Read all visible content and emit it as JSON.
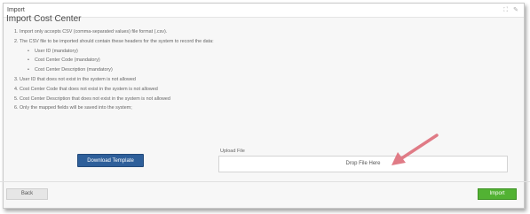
{
  "window": {
    "title": "Import",
    "controls": "⛶ ✎"
  },
  "page": {
    "heading": "Import Cost Center",
    "rules": [
      "1. Import only accepts CSV (comma-separated values) file format (.csv).",
      "2. The CSV file to be imported should contain these headers for the system to record the data:",
      "User ID (mandatory)",
      "Cost Center Code (mandatory)",
      "Cost Center Description (mandatory)",
      "3. User ID that does not exist in the system is not allowed",
      "4. Cost Center Code that does not exist in the system is not allowed",
      "5. Cost Center Description that does not exist in the system is not allowed",
      "6. Only the mapped fields will be saved into the system;"
    ],
    "bullet": "•"
  },
  "download": {
    "label": "Download Template"
  },
  "upload": {
    "label": "Upload File",
    "drop_text": "Drop File Here"
  },
  "footer": {
    "back_label": "Back",
    "import_label": "Import"
  },
  "colors": {
    "download_button": "#2e5f9a",
    "import_button": "#52b233",
    "annotation_arrow": "#e07b86"
  }
}
